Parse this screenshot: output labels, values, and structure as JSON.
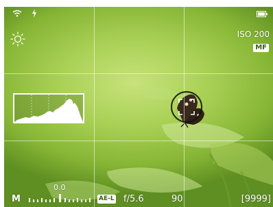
{
  "status": {
    "wifi_icon": "wifi-icon",
    "flash_icon": "flash-icon",
    "battery_icon": "battery-icon"
  },
  "left": {
    "white_balance_icon": "daylight-wb-icon"
  },
  "right": {
    "iso": "ISO 200",
    "focus_mode": "MF"
  },
  "bottom": {
    "mode": "M",
    "exposure_compensation": "0.0",
    "ae_lock": "AE-L",
    "aperture": "f/5.6",
    "shutter": "90",
    "shots_remaining": "[9999]"
  },
  "colors": {
    "overlay": "#ffffff",
    "badge_text": "#3d5f13"
  }
}
